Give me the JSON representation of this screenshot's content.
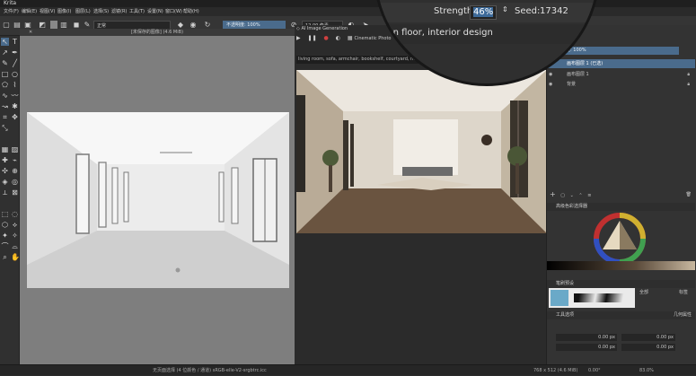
{
  "app": {
    "title": "Krita"
  },
  "menu": [
    "文件(F)",
    "编辑(E)",
    "视图(V)",
    "图像(I)",
    "图层(L)",
    "选择(S)",
    "滤镜(R)",
    "工具(T)",
    "设置(N)",
    "窗口(W)",
    "帮助(H)"
  ],
  "toolbar": {
    "blend_mode": "正常",
    "opacity": "不透明度: 100%",
    "size": "12.00 像素"
  },
  "document": {
    "tab_title": "[未保存的图像] (4.6 MiB)"
  },
  "generation": {
    "tab_title": "AI Image Generation",
    "mode": "Cinematic Photo",
    "prompt": "living room, sofa, armchair, bookshelf, courtyard, modern floor, interior design"
  },
  "magnifier": {
    "prompt_fragment": "oden floor, interior design",
    "strength_label": "Strength:",
    "strength_value": "46%",
    "seed_label": "Seed:",
    "seed_value": "17342"
  },
  "layers": {
    "opacity_label": "不透明度: 100%",
    "items": [
      {
        "name": "画布图层 1 (已选)",
        "selected": true
      },
      {
        "name": "画布图层 1",
        "selected": false
      },
      {
        "name": "背景",
        "selected": false
      }
    ]
  },
  "color_panel": {
    "title": "高级色彩选择器"
  },
  "brush_panel": {
    "title": "笔刷预设",
    "filter": "全部",
    "tag": "标签"
  },
  "tool_options": {
    "title": "工具选项",
    "right_label": "几何属性",
    "x_value": "0.00 px",
    "y_value": "0.00 px",
    "w_value": "0.00 px",
    "h_value": "0.00 px"
  },
  "status": {
    "left": "无页面选择 (4 位颜色 / 通道) sRGB-elle-V2-srgbtrc.icc",
    "size": "768 x 512 (4.6 MiB)",
    "zoom": "83.0%",
    "angle": "0.00°"
  },
  "colors": {
    "accent": "#4a6b8c",
    "selection": "#3d6a99"
  }
}
